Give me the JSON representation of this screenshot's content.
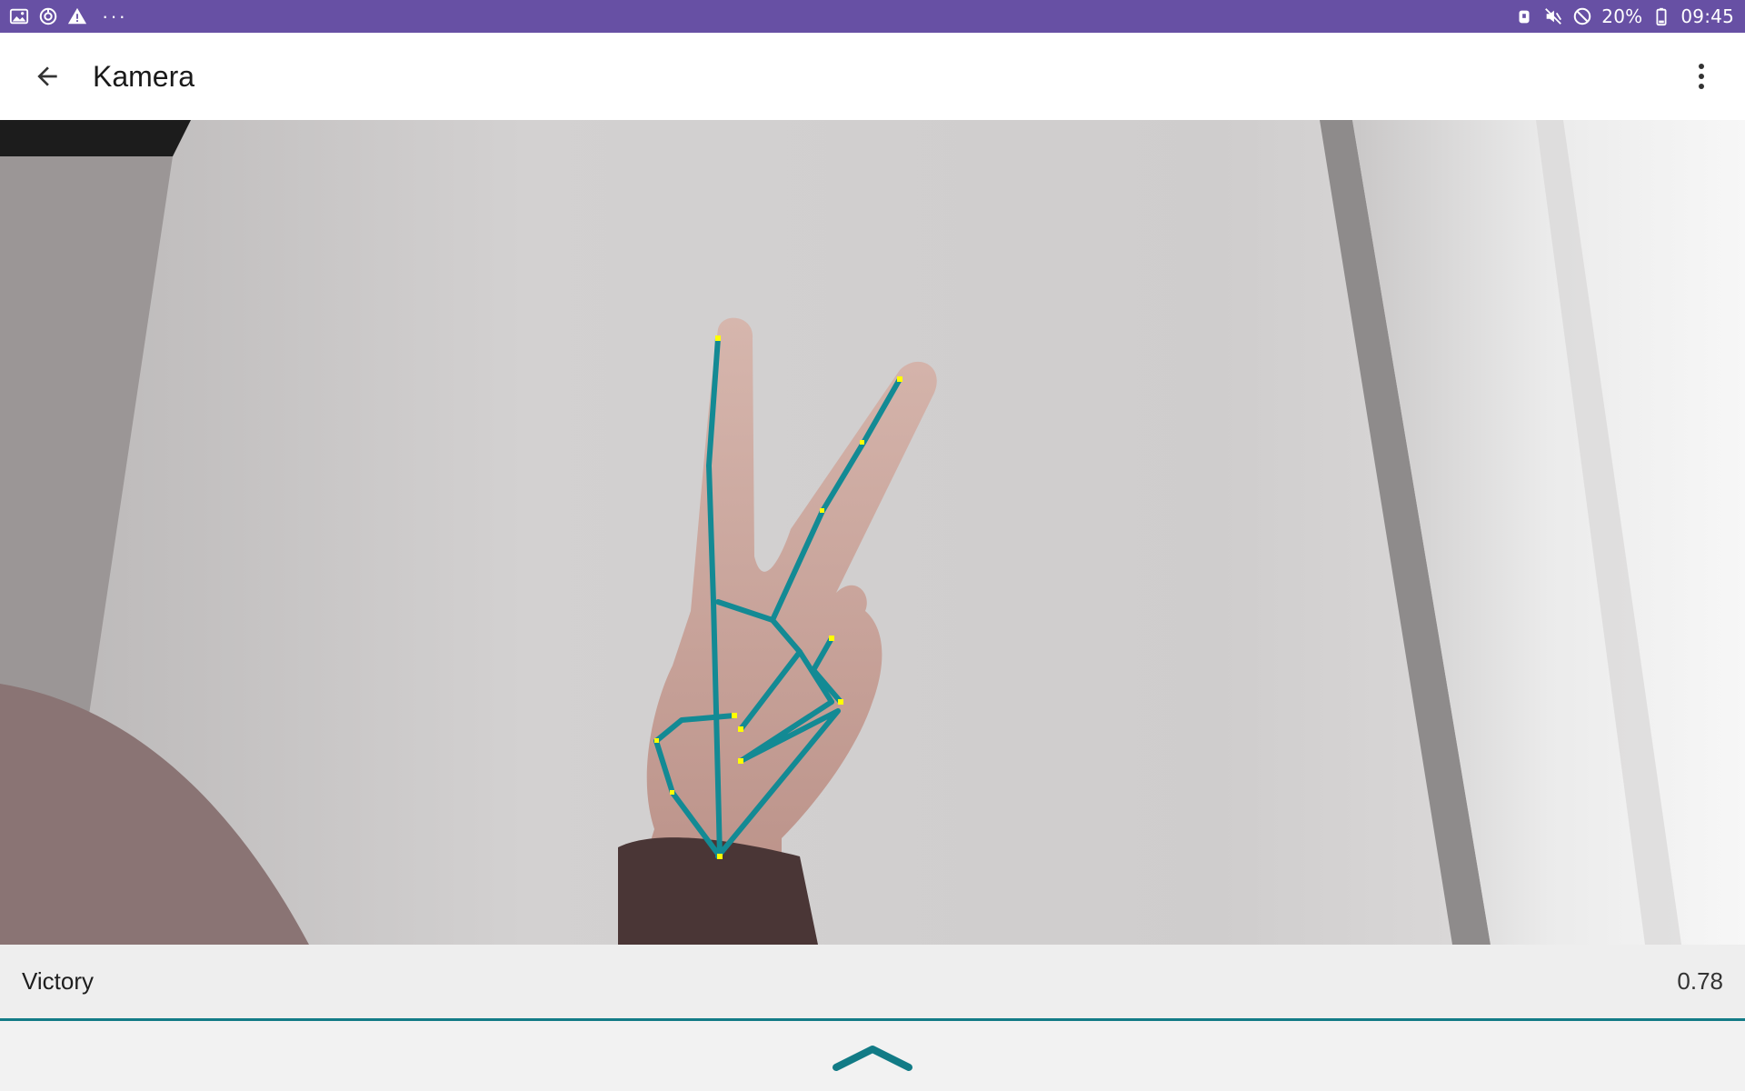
{
  "status_bar": {
    "left_icons": [
      "image-icon",
      "sync-icon",
      "warning-icon"
    ],
    "more": "···",
    "right_icons": [
      "alarm-icon",
      "mute-icon",
      "dnd-icon"
    ],
    "battery": "20%",
    "time": "09:45"
  },
  "app_bar": {
    "title": "Kamera",
    "back_icon": "arrow-back-icon",
    "menu_icon": "more-vert-icon"
  },
  "camera": {
    "overlay_color": "#138a94",
    "keypoint_color": "#ffff00"
  },
  "result": {
    "label": "Victory",
    "score": "0.78"
  },
  "colors": {
    "status_bar": "#6750a4",
    "accent": "#127b86"
  }
}
